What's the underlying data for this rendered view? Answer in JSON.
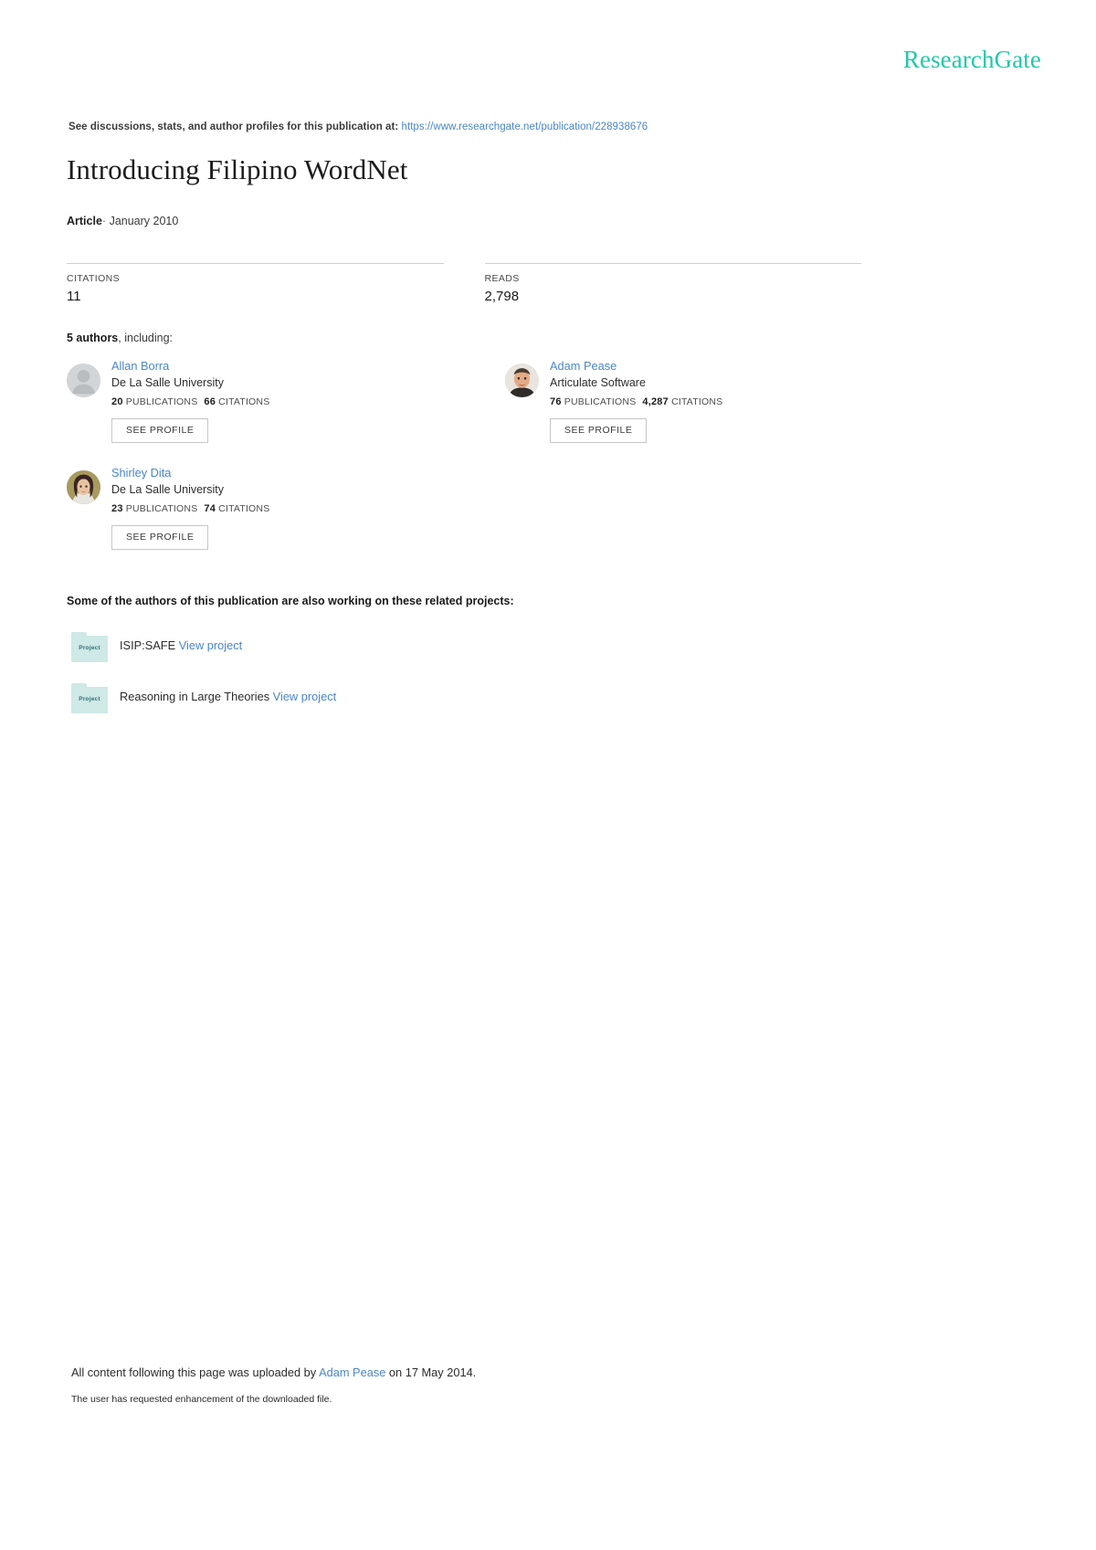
{
  "brand": {
    "name": "ResearchGate",
    "accent_color": "#22c7a9"
  },
  "discussion": {
    "prefix": "See discussions, stats, and author profiles for this publication at:",
    "url": "https://www.researchgate.net/publication/228938676",
    "link_color": "#4a86c8"
  },
  "publication": {
    "title": "Introducing Filipino WordNet",
    "type": "Article",
    "separator": "·",
    "date": "January 2010"
  },
  "stats": {
    "citations": {
      "label": "CITATIONS",
      "value": "11"
    },
    "reads": {
      "label": "READS",
      "value": "2,798"
    }
  },
  "authors_section": {
    "count_label": "5 authors",
    "count_suffix": ", including:",
    "see_profile_label": "SEE PROFILE",
    "publications_word": "PUBLICATIONS",
    "citations_word": "CITATIONS",
    "authors": [
      {
        "name": "Allan Borra",
        "affiliation": "De La Salle University",
        "publications": "20",
        "citations": "66",
        "avatar": "generic-person-icon"
      },
      {
        "name": "Adam Pease",
        "affiliation": "Articulate Software",
        "publications": "76",
        "citations": "4,287",
        "avatar": "photo-adam-pease"
      },
      {
        "name": "Shirley Dita",
        "affiliation": "De La Salle University",
        "publications": "23",
        "citations": "74",
        "avatar": "photo-shirley-dita"
      }
    ]
  },
  "projects_section": {
    "heading": "Some of the authors of this publication are also working on these related projects:",
    "icon_label": "Project",
    "view_label": "View project",
    "projects": [
      {
        "title": "ISIP:SAFE"
      },
      {
        "title": "Reasoning in Large Theories"
      }
    ]
  },
  "footer": {
    "prefix": "All content following this page was uploaded by",
    "uploader": "Adam Pease",
    "suffix": "on 17 May 2014.",
    "note": "The user has requested enhancement of the downloaded file."
  }
}
